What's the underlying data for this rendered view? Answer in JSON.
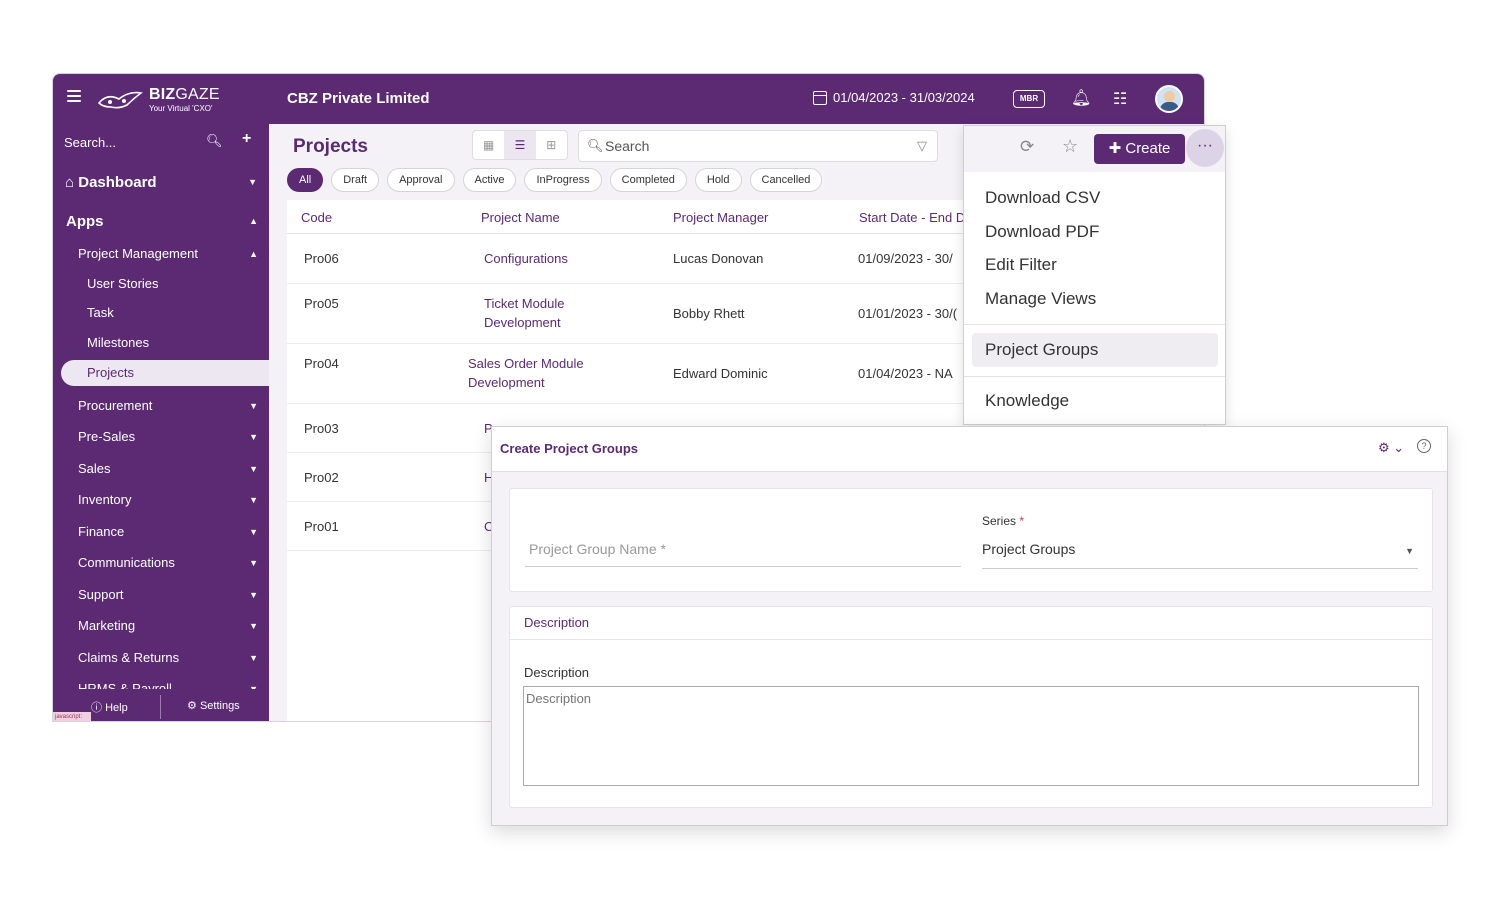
{
  "topbar": {
    "logo_main": "BIZ",
    "logo_main_light": "GAZE",
    "logo_tagline": "Your Virtual 'CXO'",
    "company": "CBZ Private Limited",
    "date_range": "01/04/2023 - 31/03/2024",
    "mbr_label": "MBR"
  },
  "sidebar": {
    "search_placeholder": "Search...",
    "dashboard": "Dashboard",
    "apps": "Apps",
    "project_management": "Project Management",
    "sub_items": [
      "User Stories",
      "Task",
      "Milestones",
      "Projects"
    ],
    "items": [
      "Procurement",
      "Pre-Sales",
      "Sales",
      "Inventory",
      "Finance",
      "Communications",
      "Support",
      "Marketing",
      "Claims & Returns",
      "HRMS & Payroll"
    ],
    "help": "Help",
    "settings": "Settings",
    "js_tag": "javascript:"
  },
  "main": {
    "title": "Projects",
    "search_placeholder": "Search",
    "chips": [
      "All",
      "Draft",
      "Approval",
      "Active",
      "InProgress",
      "Completed",
      "Hold",
      "Cancelled"
    ],
    "columns": [
      "Code",
      "Project Name",
      "Project Manager",
      "Start Date - End D"
    ],
    "rows": [
      {
        "code": "Pro06",
        "name1": "Configurations",
        "name2": "",
        "manager": "Lucas Donovan",
        "dates": "01/09/2023 - 30/"
      },
      {
        "code": "Pro05",
        "name1": "Ticket Module",
        "name2": "Development",
        "manager": "Bobby Rhett",
        "dates": "01/01/2023 - 30/("
      },
      {
        "code": "Pro04",
        "name1": "Sales Order Module",
        "name2": "Development",
        "manager": "Edward Dominic",
        "dates": "01/04/2023 - NA"
      },
      {
        "code": "Pro03",
        "name1": "P",
        "name2": "",
        "manager": "",
        "dates": ""
      },
      {
        "code": "Pro02",
        "name1": "H",
        "name2": "",
        "manager": "",
        "dates": ""
      },
      {
        "code": "Pro01",
        "name1": "C",
        "name2": "",
        "manager": "",
        "dates": ""
      }
    ]
  },
  "dropdown": {
    "create_label": "Create",
    "more_label": "···",
    "items": [
      "Download CSV",
      "Download PDF",
      "Edit Filter",
      "Manage Views",
      "Project Groups",
      "Knowledge"
    ]
  },
  "modal": {
    "title": "Create Project Groups",
    "help": "?",
    "group_name_placeholder": "Project Group Name *",
    "series_label": "Series",
    "series_required": "*",
    "series_value": "Project Groups",
    "description_section": "Description",
    "description_label": "Description",
    "description_placeholder": "Description"
  }
}
